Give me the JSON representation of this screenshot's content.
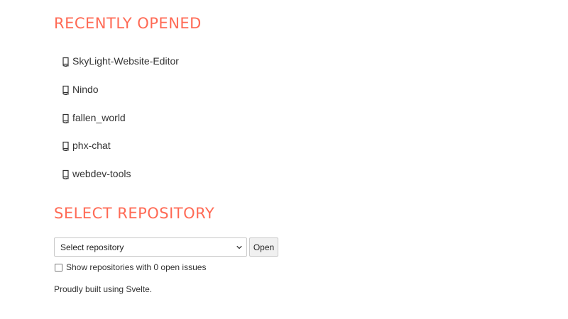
{
  "recent": {
    "title": "RECENTLY OPENED",
    "items": [
      {
        "label": "SkyLight-Website-Editor",
        "icon": "repo-icon"
      },
      {
        "label": "Nindo",
        "icon": "repo-icon"
      },
      {
        "label": "fallen_world",
        "icon": "repo-icon"
      },
      {
        "label": "phx-chat",
        "icon": "repo-icon"
      },
      {
        "label": "webdev-tools",
        "icon": "repo-icon"
      }
    ]
  },
  "select_repo": {
    "title": "SELECT REPOSITORY",
    "select_value": "Select repository",
    "open_label": "Open",
    "checkbox_label": "Show repositories with 0 open issues",
    "checkbox_checked": false
  },
  "footer": {
    "text": "Proudly built using Svelte."
  },
  "colors": {
    "accent": "#ff6a55"
  }
}
